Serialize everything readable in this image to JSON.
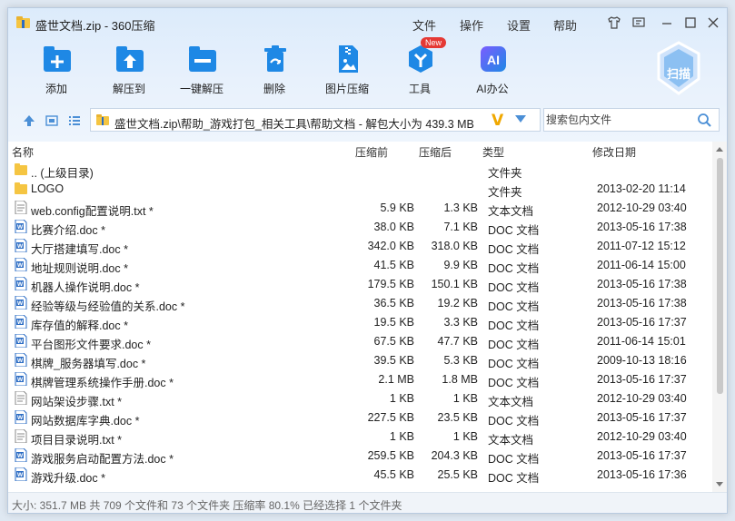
{
  "window": {
    "title": "盛世文档.zip - 360压缩",
    "menu": [
      "文件",
      "操作",
      "设置",
      "帮助"
    ]
  },
  "toolbar": {
    "tools": [
      {
        "label": "添加",
        "icon": "add-icon"
      },
      {
        "label": "解压到",
        "icon": "extract-to-icon"
      },
      {
        "label": "一键解压",
        "icon": "one-click-extract-icon"
      },
      {
        "label": "删除",
        "icon": "delete-icon"
      },
      {
        "label": "图片压缩",
        "icon": "image-compress-icon"
      },
      {
        "label": "工具",
        "icon": "tools-icon",
        "badge": "New"
      },
      {
        "label": "AI办公",
        "icon": "ai-office-icon"
      }
    ],
    "scan_label": "扫描"
  },
  "nav": {
    "path": "盛世文档.zip\\帮助_游戏打包_相关工具\\帮助文档 - 解包大小为 439.3 MB",
    "search_placeholder": "搜索包内文件"
  },
  "columns": {
    "name": "名称",
    "before": "压缩前",
    "after": "压缩后",
    "type": "类型",
    "date": "修改日期"
  },
  "files": [
    {
      "name": ".. (上级目录)",
      "before": "",
      "after": "",
      "type": "文件夹",
      "date": "",
      "kind": "folder"
    },
    {
      "name": "LOGO",
      "before": "",
      "after": "",
      "type": "文件夹",
      "date": "2013-02-20 11:14",
      "kind": "folder"
    },
    {
      "name": "web.config配置说明.txt *",
      "before": "5.9 KB",
      "after": "1.3 KB",
      "type": "文本文档",
      "date": "2012-10-29 03:40",
      "kind": "txt"
    },
    {
      "name": "比赛介绍.doc *",
      "before": "38.0 KB",
      "after": "7.1 KB",
      "type": "DOC 文档",
      "date": "2013-05-16 17:38",
      "kind": "doc"
    },
    {
      "name": "大厅搭建填写.doc *",
      "before": "342.0 KB",
      "after": "318.0 KB",
      "type": "DOC 文档",
      "date": "2011-07-12 15:12",
      "kind": "doc"
    },
    {
      "name": "地址规则说明.doc *",
      "before": "41.5 KB",
      "after": "9.9 KB",
      "type": "DOC 文档",
      "date": "2011-06-14 15:00",
      "kind": "doc"
    },
    {
      "name": "机器人操作说明.doc *",
      "before": "179.5 KB",
      "after": "150.1 KB",
      "type": "DOC 文档",
      "date": "2013-05-16 17:38",
      "kind": "doc"
    },
    {
      "name": "经验等级与经验值的关系.doc *",
      "before": "36.5 KB",
      "after": "19.2 KB",
      "type": "DOC 文档",
      "date": "2013-05-16 17:38",
      "kind": "doc"
    },
    {
      "name": "库存值的解释.doc *",
      "before": "19.5 KB",
      "after": "3.3 KB",
      "type": "DOC 文档",
      "date": "2013-05-16 17:37",
      "kind": "doc"
    },
    {
      "name": "平台图形文件要求.doc *",
      "before": "67.5 KB",
      "after": "47.7 KB",
      "type": "DOC 文档",
      "date": "2011-06-14 15:01",
      "kind": "doc"
    },
    {
      "name": "棋牌_服务器填写.doc *",
      "before": "39.5 KB",
      "after": "5.3 KB",
      "type": "DOC 文档",
      "date": "2009-10-13 18:16",
      "kind": "doc"
    },
    {
      "name": "棋牌管理系统操作手册.doc *",
      "before": "2.1 MB",
      "after": "1.8 MB",
      "type": "DOC 文档",
      "date": "2013-05-16 17:37",
      "kind": "doc"
    },
    {
      "name": "网站架设步骤.txt *",
      "before": "1 KB",
      "after": "1 KB",
      "type": "文本文档",
      "date": "2012-10-29 03:40",
      "kind": "txt"
    },
    {
      "name": "网站数据库字典.doc *",
      "before": "227.5 KB",
      "after": "23.5 KB",
      "type": "DOC 文档",
      "date": "2013-05-16 17:37",
      "kind": "doc"
    },
    {
      "name": "项目目录说明.txt *",
      "before": "1 KB",
      "after": "1 KB",
      "type": "文本文档",
      "date": "2012-10-29 03:40",
      "kind": "txt"
    },
    {
      "name": "游戏服务启动配置方法.doc *",
      "before": "259.5 KB",
      "after": "204.3 KB",
      "type": "DOC 文档",
      "date": "2013-05-16 17:37",
      "kind": "doc"
    },
    {
      "name": "游戏升级.doc *",
      "before": "45.5 KB",
      "after": "25.5 KB",
      "type": "DOC 文档",
      "date": "2013-05-16 17:36",
      "kind": "doc"
    }
  ],
  "status": "大小: 351.7 MB 共 709 个文件和 73 个文件夹 压缩率 80.1% 已经选择 1 个文件夹",
  "colors": {
    "accent": "#1e88e5",
    "header_bg": "#e3eefb",
    "doc_icon": "#2b6cc4",
    "folder_icon": "#f5c542"
  }
}
